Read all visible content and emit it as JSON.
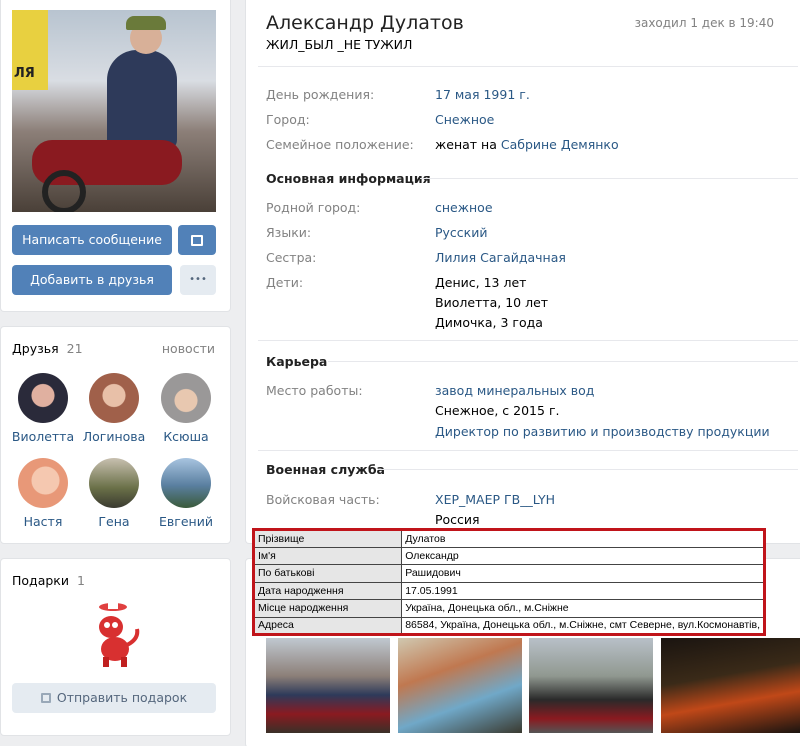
{
  "profile": {
    "name": "Александр Дулатов",
    "status": "ЖИЛ_БЫЛ _НЕ ТУЖИЛ",
    "last_seen": "заходил 1 дек в 19:40"
  },
  "actions": {
    "message": "Написать сообщение",
    "add_friend": "Добавить в друзья",
    "more": "•••"
  },
  "info": {
    "birthday_label": "День рождения:",
    "birthday_value": "17 мая 1991 г.",
    "city_label": "Город:",
    "city_value": "Снежное",
    "family_label": "Семейное положение:",
    "family_prefix": "женат на",
    "family_link": "Сабрине Демянко"
  },
  "main_info": {
    "title": "Основная информация",
    "hometown_label": "Родной город:",
    "hometown_value": "снежное",
    "languages_label": "Языки:",
    "languages_value": "Русский",
    "sister_label": "Сестра:",
    "sister_value": "Лилия Сагайдачная",
    "children_label": "Дети:",
    "children": [
      "Денис, 13 лет",
      "Виолетта, 10 лет",
      "Димочка, 3 года"
    ]
  },
  "career": {
    "title": "Карьера",
    "work_label": "Место работы:",
    "work_value": "завод минеральных вод",
    "work_place": "Снежное, с 2015 г.",
    "work_position": "Директор по развитию и производству продукции"
  },
  "military": {
    "title": "Военная служба",
    "unit_label": "Войсковая часть:",
    "unit_value": "ХЕР_МАЕР ГВ__LYH",
    "country": "Россия"
  },
  "friends": {
    "title": "Друзья",
    "count": "21",
    "news": "новости",
    "items": [
      {
        "name": "Виолетта",
        "color": "#3b3a4a"
      },
      {
        "name": "Логинова",
        "color": "#a0604a"
      },
      {
        "name": "Ксюша",
        "color": "#8a8888"
      },
      {
        "name": "Настя",
        "color": "#e8a088"
      },
      {
        "name": "Гена",
        "color": "#6a7048"
      },
      {
        "name": "Евгений",
        "color": "#5a7fa0"
      }
    ]
  },
  "gifts": {
    "title": "Подарки",
    "count": "1",
    "send": "Отправить подарок"
  },
  "overlay_table": [
    {
      "key": "Прізвище",
      "value": "Дулатов"
    },
    {
      "key": "Ім'я",
      "value": "Олександр"
    },
    {
      "key": "По батькові",
      "value": "Рашидович"
    },
    {
      "key": "Дата народження",
      "value": "17.05.1991"
    },
    {
      "key": "Місце народження",
      "value": "Україна, Донецька обл., м.Сніжне"
    },
    {
      "key": "Адреса",
      "value": "86584, Україна, Донецька обл., м.Сніжне, смт Северне, вул.Космонавтів,"
    }
  ],
  "avatar_banner": "ЛЯ"
}
